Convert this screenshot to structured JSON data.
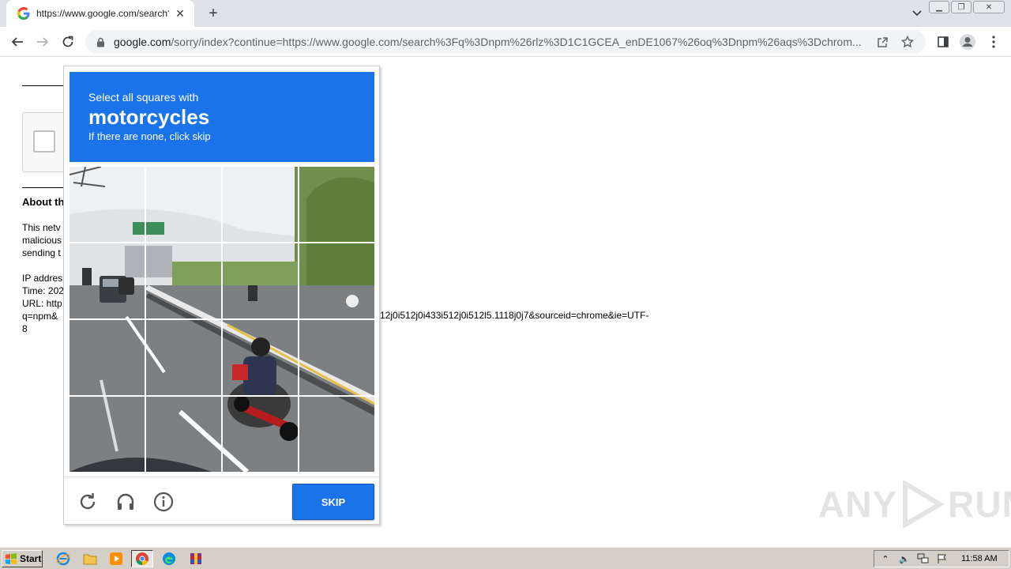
{
  "browser": {
    "tab_title": "https://www.google.com/search?q=",
    "url_host": "google.com",
    "url_rest": "/sorry/index?continue=https://www.google.com/search%3Fq%3Dnpm%26rlz%3D1C1GCEA_enDE1067%26oq%3Dnpm%26aqs%3Dchrom..."
  },
  "page": {
    "about_heading": "About th",
    "para1": [
      "This netv",
      "malicious",
      "sending t"
    ],
    "ip_label": "IP addres",
    "time_label": "Time: 202",
    "url_label": "URL: http",
    "url_line2": "q=npm&",
    "url_line3": "8",
    "url_tail": "12j0i512j0i433i512j0i512l5.1118j0j7&sourceid=chrome&ie=UTF-"
  },
  "captcha": {
    "instruction": "Select all squares with",
    "target_word": "motorcycles",
    "hint": "If there are none, click skip",
    "skip_label": "SKIP"
  },
  "watermark": {
    "left": "ANY",
    "right": "RUN"
  },
  "taskbar": {
    "start_label": "Start",
    "clock": "11:58 AM"
  },
  "colors": {
    "captcha_blue": "#1a73e8",
    "tab_strip": "#dee1e6",
    "taskbar": "#d4d0c8"
  }
}
